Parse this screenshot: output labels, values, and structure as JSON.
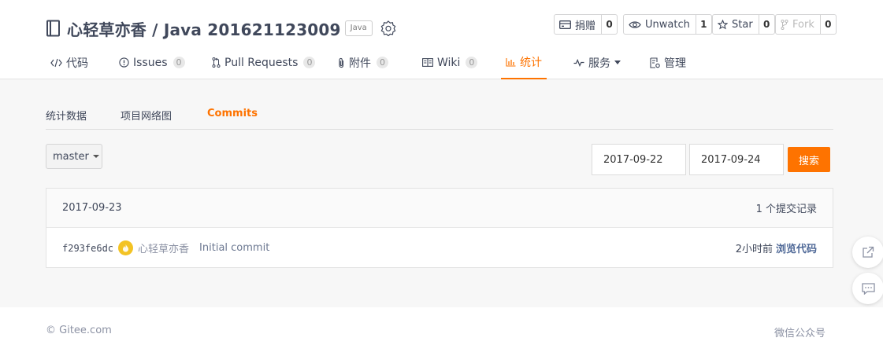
{
  "repo": {
    "title": "心轻草亦香 / Java 201621123009",
    "language": "Java"
  },
  "actions": {
    "donate": {
      "label": "捐赠",
      "count": "0"
    },
    "watch": {
      "label": "Unwatch",
      "count": "1"
    },
    "star": {
      "label": "Star",
      "count": "0"
    },
    "fork": {
      "label": "Fork",
      "count": "0"
    }
  },
  "tabs": [
    {
      "label": "代码",
      "icon": "code-icon"
    },
    {
      "label": "Issues",
      "count": "0",
      "icon": "issue-icon"
    },
    {
      "label": "Pull Requests",
      "count": "0",
      "icon": "pull-request-icon"
    },
    {
      "label": "附件",
      "count": "0",
      "icon": "paperclip-icon"
    },
    {
      "label": "Wiki",
      "count": "0",
      "icon": "wiki-icon"
    },
    {
      "label": "统计",
      "icon": "chart-icon",
      "active": true
    },
    {
      "label": "服务",
      "icon": "pulse-icon"
    },
    {
      "label": "管理",
      "icon": "settings-doc-icon"
    }
  ],
  "subnav": [
    "统计数据",
    "项目网络图",
    "Commits"
  ],
  "branch": {
    "label": "master"
  },
  "filter": {
    "start_date": "2017-09-22",
    "end_date": "2017-09-24",
    "search_label": "搜索"
  },
  "commits": {
    "date": "2017-09-23",
    "summary": "1 个提交记录",
    "rows": [
      {
        "sha": "f293fe6dc",
        "author": "心轻草亦香",
        "message": "Initial commit",
        "time": "2小时前",
        "browse": "浏览代码"
      }
    ]
  },
  "footer": {
    "copyright": "© Gitee.com",
    "wechat": "微信公众号"
  },
  "colors": {
    "accent": "#fe7300",
    "text": "#40485b",
    "link": "#4d6796"
  }
}
